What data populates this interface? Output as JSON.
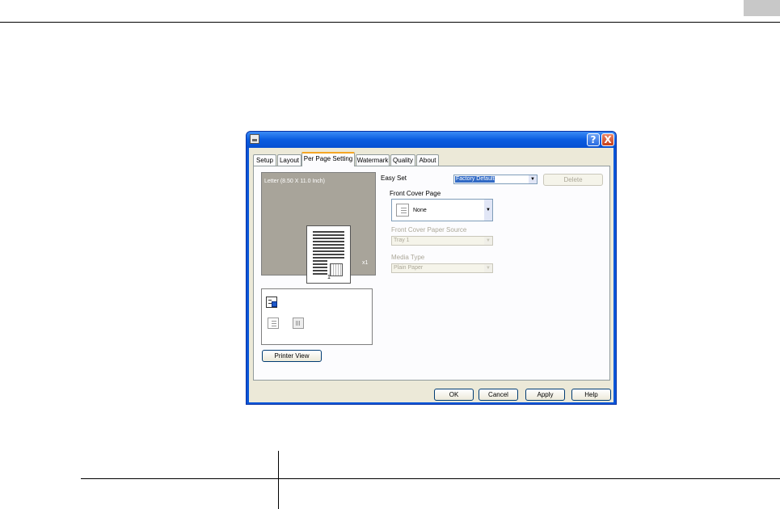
{
  "dialog": {
    "title": "",
    "titlebar_buttons": {
      "help": "?",
      "close": "X"
    },
    "tabs": [
      {
        "label": "Setup",
        "active": false
      },
      {
        "label": "Layout",
        "active": false
      },
      {
        "label": "Per Page Setting",
        "active": true
      },
      {
        "label": "Watermark",
        "active": false
      },
      {
        "label": "Quality",
        "active": false
      },
      {
        "label": "About",
        "active": false
      }
    ],
    "preview": {
      "paper_label": "Letter (8.50 X 11.0 Inch)",
      "copies": "x1",
      "page_number": "1"
    },
    "printer_view_label": "Printer View",
    "easy_set": {
      "label": "Easy Set",
      "value": "Factory Default",
      "delete_label": "Delete"
    },
    "front_cover_page": {
      "label": "Front Cover Page",
      "value": "None"
    },
    "front_cover_paper_source": {
      "label": "Front Cover Paper Source",
      "value": "Tray 1"
    },
    "media_type": {
      "label": "Media Type",
      "value": "Plain Paper"
    },
    "footer_buttons": {
      "ok": "OK",
      "cancel": "Cancel",
      "apply": "Apply",
      "help": "Help"
    }
  },
  "colors": {
    "titlebar": "#0a56d8",
    "dialog_face": "#ece9d8",
    "preview_bg": "#a8a49a",
    "active_tab_accent": "#f5a623"
  },
  "icons": {
    "app": "printer-icon",
    "info_row1": "duplex-pages-icon",
    "info_row2a": "cover-sheet-icon",
    "info_row2b": "stapled-page-icon"
  }
}
